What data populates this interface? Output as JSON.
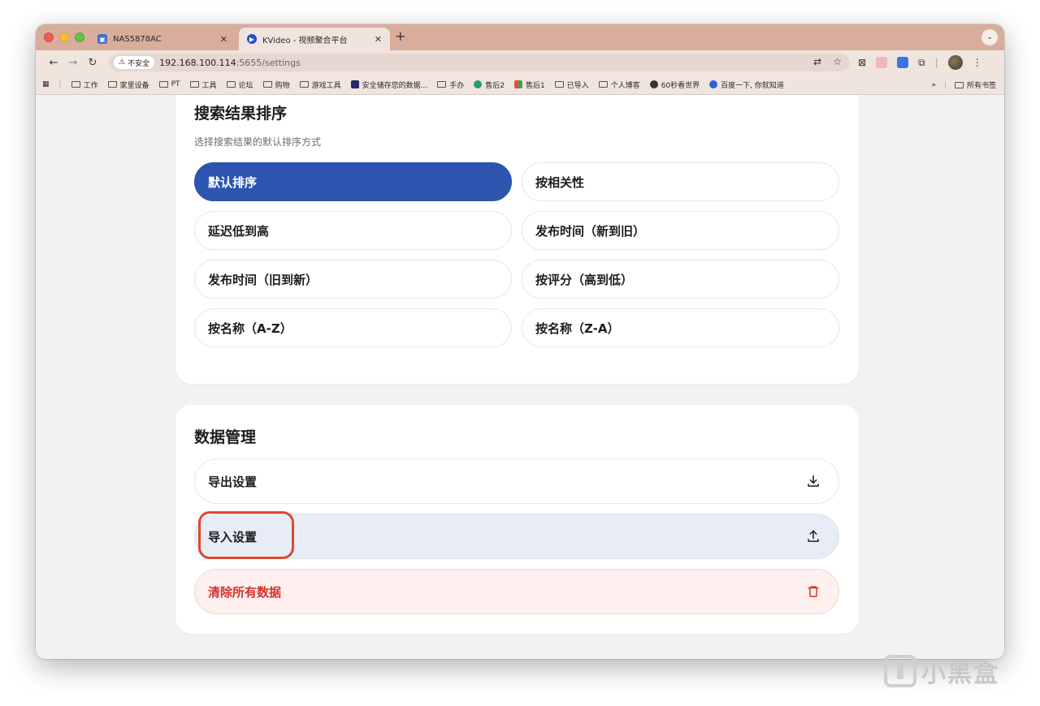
{
  "browser": {
    "tabs": [
      {
        "title": "NAS5878AC",
        "active": false
      },
      {
        "title": "KVideo - 视频聚合平台",
        "active": true
      }
    ],
    "url_host": "192.168.100.114",
    "url_path": ":5655/settings",
    "security_label": "不安全",
    "bookmarks": [
      {
        "label": "工作",
        "icon": "folder-icon"
      },
      {
        "label": "家里设备",
        "icon": "folder-icon"
      },
      {
        "label": "PT",
        "icon": "folder-icon"
      },
      {
        "label": "工具",
        "icon": "folder-icon"
      },
      {
        "label": "论坛",
        "icon": "folder-icon"
      },
      {
        "label": "购物",
        "icon": "folder-icon"
      },
      {
        "label": "游戏工具",
        "icon": "folder-icon"
      },
      {
        "label": "安全储存您的数据...",
        "icon": "site-icon"
      },
      {
        "label": "手办",
        "icon": "folder-icon"
      },
      {
        "label": "售后2",
        "icon": "site-icon"
      },
      {
        "label": "售后1",
        "icon": "site-icon"
      },
      {
        "label": "已导入",
        "icon": "folder-icon"
      },
      {
        "label": "个人博客",
        "icon": "folder-icon"
      },
      {
        "label": "60秒看世界",
        "icon": "site-icon"
      },
      {
        "label": "百度一下, 你就知道",
        "icon": "site-icon"
      }
    ],
    "all_bookmarks_label": "所有书签"
  },
  "sort_section": {
    "title": "搜索结果排序",
    "subtitle": "选择搜索结果的默认排序方式",
    "options": [
      {
        "label": "默认排序",
        "selected": true
      },
      {
        "label": "按相关性",
        "selected": false
      },
      {
        "label": "延迟低到高",
        "selected": false
      },
      {
        "label": "发布时间（新到旧）",
        "selected": false
      },
      {
        "label": "发布时间（旧到新）",
        "selected": false
      },
      {
        "label": "按评分（高到低）",
        "selected": false
      },
      {
        "label": "按名称（A-Z）",
        "selected": false
      },
      {
        "label": "按名称（Z-A）",
        "selected": false
      }
    ]
  },
  "data_section": {
    "title": "数据管理",
    "export_label": "导出设置",
    "import_label": "导入设置",
    "clear_label": "清除所有数据"
  },
  "watermark": "小黑盒",
  "colors": {
    "accent": "#2d55b0",
    "danger": "#d9302b",
    "highlight_bg": "#e8ecf5",
    "annotation": "#e0472e",
    "tabstrip": "#d9ad9c"
  }
}
